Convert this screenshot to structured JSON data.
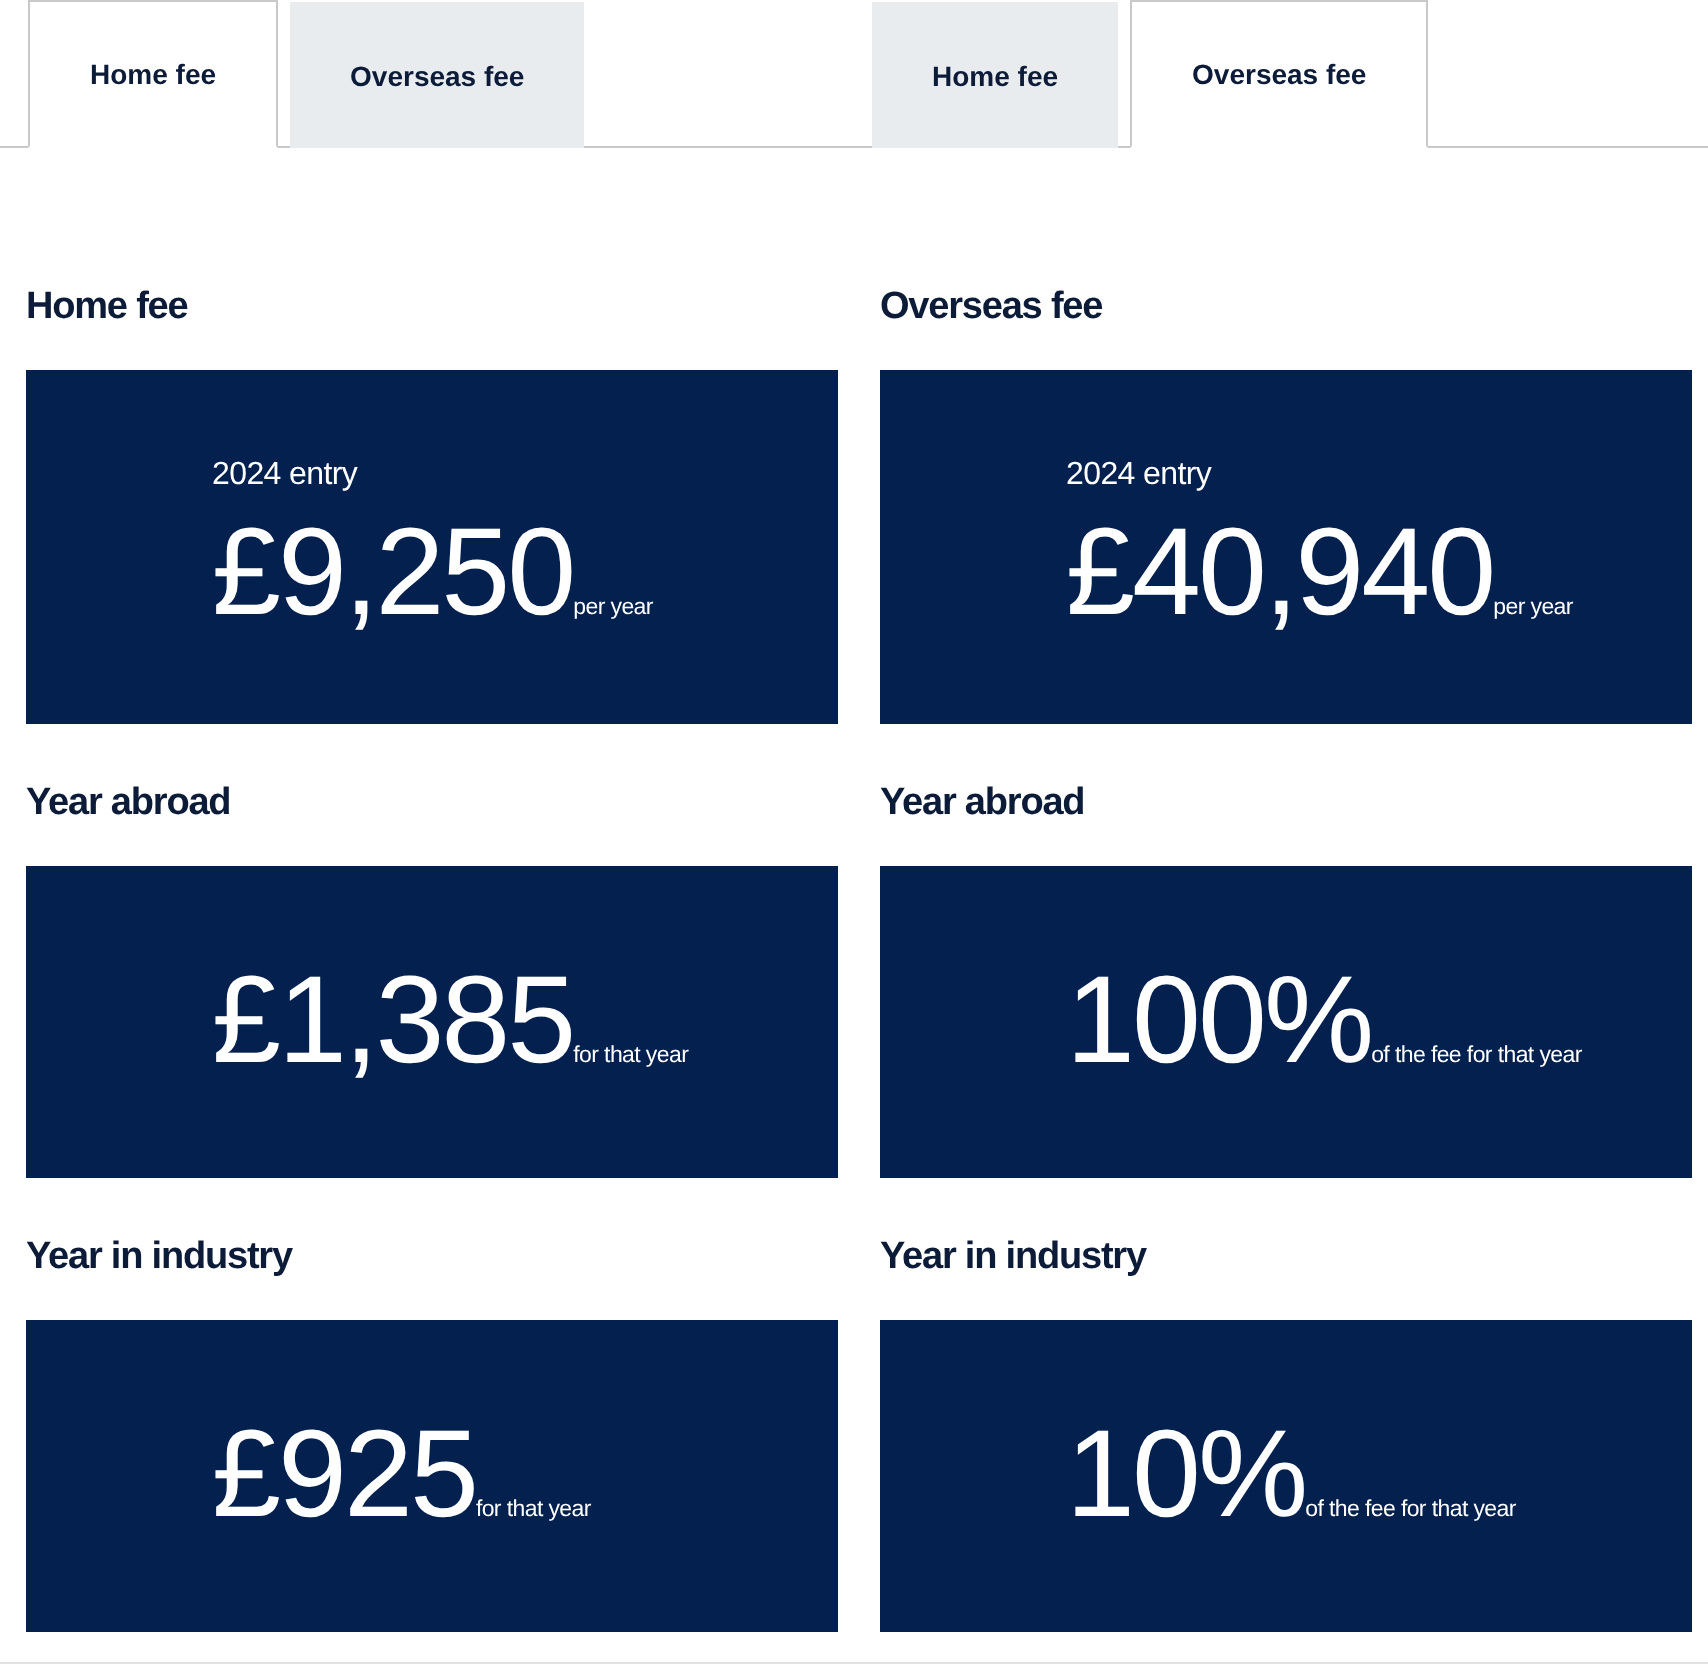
{
  "panels": [
    {
      "tabs": [
        {
          "label": "Home fee",
          "selected": true
        },
        {
          "label": "Overseas fee",
          "selected": false
        }
      ],
      "sections": [
        {
          "heading": "Home fee",
          "entry": "2024 entry",
          "amount": "£9,250",
          "unit": "per year"
        },
        {
          "heading": "Year abroad",
          "amount": "£1,385",
          "unit": "for that year"
        },
        {
          "heading": "Year in industry",
          "amount": "£925",
          "unit": "for that year"
        }
      ]
    },
    {
      "tabs": [
        {
          "label": "Home fee",
          "selected": false
        },
        {
          "label": "Overseas fee",
          "selected": true
        }
      ],
      "sections": [
        {
          "heading": "Overseas fee",
          "entry": "2024 entry",
          "amount": "£40,940",
          "unit": "per year"
        },
        {
          "heading": "Year abroad",
          "amount": "100%",
          "unit": "of the fee for that year"
        },
        {
          "heading": "Year in industry",
          "amount": "10%",
          "unit": "of the fee for that year"
        }
      ]
    }
  ]
}
